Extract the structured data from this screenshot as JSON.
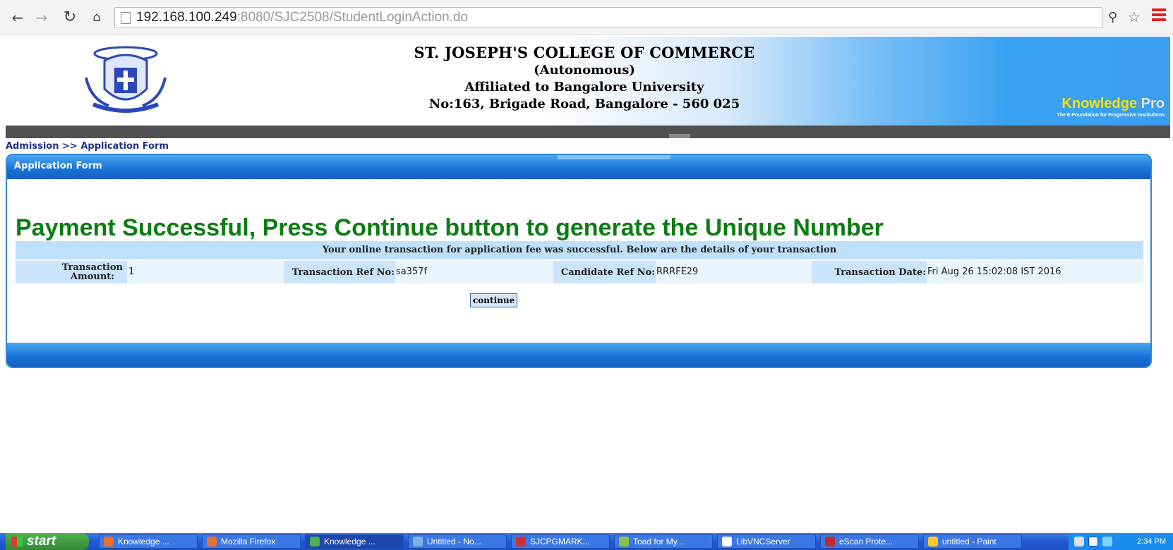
{
  "browser": {
    "url_host": "192.168.100.249",
    "url_rest": ":8080/SJC2508/StudentLoginAction.do"
  },
  "header": {
    "college_name": "ST. JOSEPH'S COLLEGE OF COMMERCE",
    "status": "(Autonomous)",
    "affiliation": "Affiliated to Bangalore University",
    "address": "No:163, Brigade Road, Bangalore - 560 025",
    "brand": "Knowledge",
    "brand_suffix": "Pro",
    "brand_tagline": "The E-Foundation for Progressive Institutions"
  },
  "breadcrumb": "Admission >> Application Form",
  "panel": {
    "title": "Application Form",
    "success_message": "Payment Successful, Press Continue button to generate the Unique Number",
    "info_message": "Your online transaction for application fee was successful. Below are the details of your transaction",
    "fields": [
      {
        "label": "Transaction Amount:",
        "value": "1"
      },
      {
        "label": "Transaction Ref No:",
        "value": "sa357f"
      },
      {
        "label": "Candidate Ref No:",
        "value": "RRRFE29"
      },
      {
        "label": "Transaction Date:",
        "value": "Fri Aug 26 15:02:08 IST 2016"
      }
    ],
    "continue_label": "continue"
  },
  "taskbar": {
    "start_label": "start",
    "tasks": [
      {
        "label": "Knowledge ...",
        "icon": "firefox-icon",
        "color": "#e8702a",
        "active": false
      },
      {
        "label": "Mozilla Firefox",
        "icon": "firefox-icon",
        "color": "#e8702a",
        "active": false
      },
      {
        "label": "Knowledge ...",
        "icon": "chrome-icon",
        "color": "#4caf50",
        "active": true
      },
      {
        "label": "Untitled - No...",
        "icon": "notepad-icon",
        "color": "#7fb3e8",
        "active": false
      },
      {
        "label": "SJCPGMARK...",
        "icon": "pdf-icon",
        "color": "#d32f2f",
        "active": false
      },
      {
        "label": "Toad for My...",
        "icon": "toad-icon",
        "color": "#8bc34a",
        "active": false
      },
      {
        "label": "LibVNCServer",
        "icon": "vnc-icon",
        "color": "#ffffff",
        "active": false
      },
      {
        "label": "eScan Prote...",
        "icon": "escan-icon",
        "color": "#c62828",
        "active": false
      },
      {
        "label": "untitled - Paint",
        "icon": "paint-icon",
        "color": "#ffca28",
        "active": false
      }
    ],
    "clock": "2:34 PM"
  }
}
